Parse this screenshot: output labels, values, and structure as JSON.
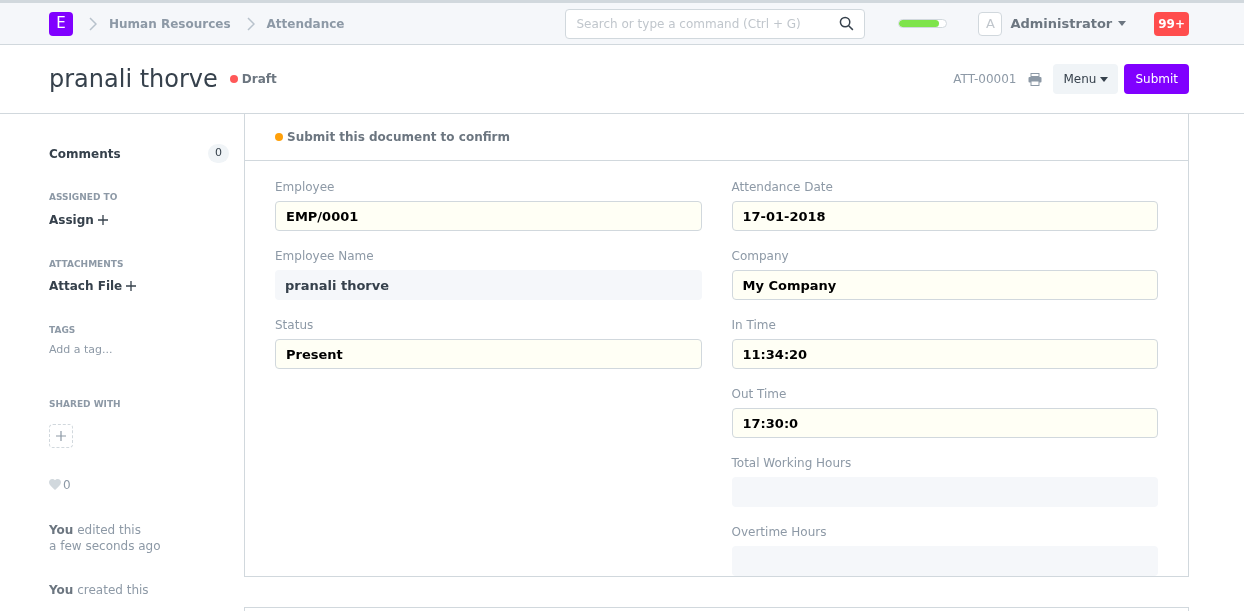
{
  "navbar": {
    "logo": "E",
    "breadcrumbs": [
      "Human Resources",
      "Attendance"
    ],
    "search": {
      "placeholder": "Search or type a command (Ctrl + G)"
    },
    "progress": {
      "level": 0.85
    },
    "user": {
      "avatar": "A",
      "name": "Administrator"
    },
    "notifications": "99+"
  },
  "header": {
    "title": "pranali thorve",
    "status": "Draft",
    "doc_id": "ATT-00001",
    "menu": "Menu",
    "submit": "Submit"
  },
  "sidebar": {
    "comments": {
      "label": "Comments",
      "count": "0"
    },
    "sections": [
      {
        "heading": "ASSIGNED TO",
        "kind": "action",
        "text": "Assign"
      },
      {
        "heading": "ATTACHMENTS",
        "kind": "action",
        "text": "Attach File"
      },
      {
        "heading": "TAGS",
        "kind": "hint",
        "text": "Add a tag..."
      },
      {
        "heading": "SHARED WITH",
        "kind": "share"
      }
    ],
    "likes": "0",
    "activity": [
      {
        "who": "You",
        "what": "edited this",
        "when": "a few seconds ago"
      },
      {
        "who": "You",
        "what": "created this"
      }
    ]
  },
  "form": {
    "indicator": "Submit this document to confirm",
    "columns": [
      [
        {
          "label": "Employee",
          "value": "EMP/0001",
          "kind": "input"
        },
        {
          "label": "Employee Name",
          "value": "pranali thorve",
          "kind": "readonly"
        },
        {
          "label": "Status",
          "value": "Present",
          "kind": "input"
        }
      ],
      [
        {
          "label": "Attendance Date",
          "value": "17-01-2018",
          "kind": "input"
        },
        {
          "label": "Company",
          "value": "My Company",
          "kind": "input"
        },
        {
          "label": "In Time",
          "value": "11:34:20",
          "kind": "input"
        },
        {
          "label": "Out Time",
          "value": "17:30:0",
          "kind": "input"
        },
        {
          "label": "Total Working Hours",
          "kind": "readonly"
        },
        {
          "label": "Overtime Hours",
          "kind": "readonly"
        }
      ]
    ]
  }
}
